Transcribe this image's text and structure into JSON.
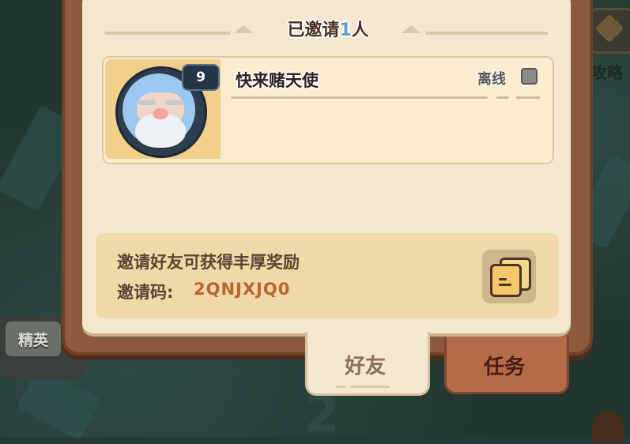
{
  "header": {
    "title_prefix": "已邀请",
    "count": "1",
    "title_suffix": "人"
  },
  "friend": {
    "level": "9",
    "name": "快来赌天使",
    "status": "离线"
  },
  "invite": {
    "description": "邀请好友可获得丰厚奖励",
    "code_label": "邀请码:",
    "code": "2QNJXJQ0"
  },
  "tabs": [
    {
      "label": "好友",
      "active": true
    },
    {
      "label": "任务",
      "active": false
    }
  ],
  "background": {
    "elite_label": "精英",
    "guide_label": "攻略",
    "number": "2"
  },
  "colors": {
    "panel": "#f3e8cf",
    "frame": "#8c5a3c",
    "accent_code": "#b8652f",
    "count_blue": "#5b9bd0"
  }
}
